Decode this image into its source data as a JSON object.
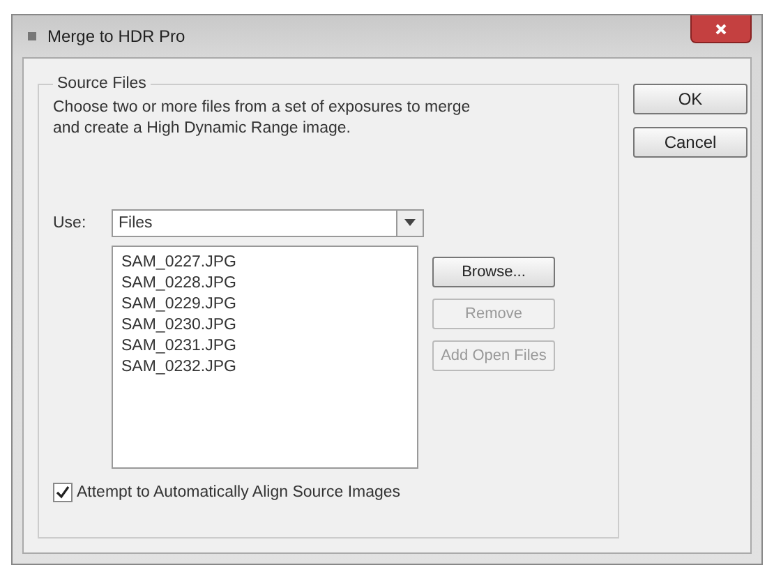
{
  "window": {
    "title": "Merge to HDR Pro"
  },
  "source_files": {
    "legend": "Source Files",
    "description": "Choose two or more files from a set of exposures to merge and create a High Dynamic Range image.",
    "use_label": "Use:",
    "use_value": "Files",
    "files": [
      "SAM_0227.JPG",
      "SAM_0228.JPG",
      "SAM_0229.JPG",
      "SAM_0230.JPG",
      "SAM_0231.JPG",
      "SAM_0232.JPG"
    ],
    "side_buttons": [
      {
        "label": "Browse...",
        "disabled": false
      },
      {
        "label": "Remove",
        "disabled": true
      },
      {
        "label": "Add Open Files",
        "disabled": true
      }
    ],
    "align": {
      "label": "Attempt to Automatically Align Source Images",
      "checked": true
    }
  },
  "buttons": [
    "OK",
    "Cancel"
  ]
}
